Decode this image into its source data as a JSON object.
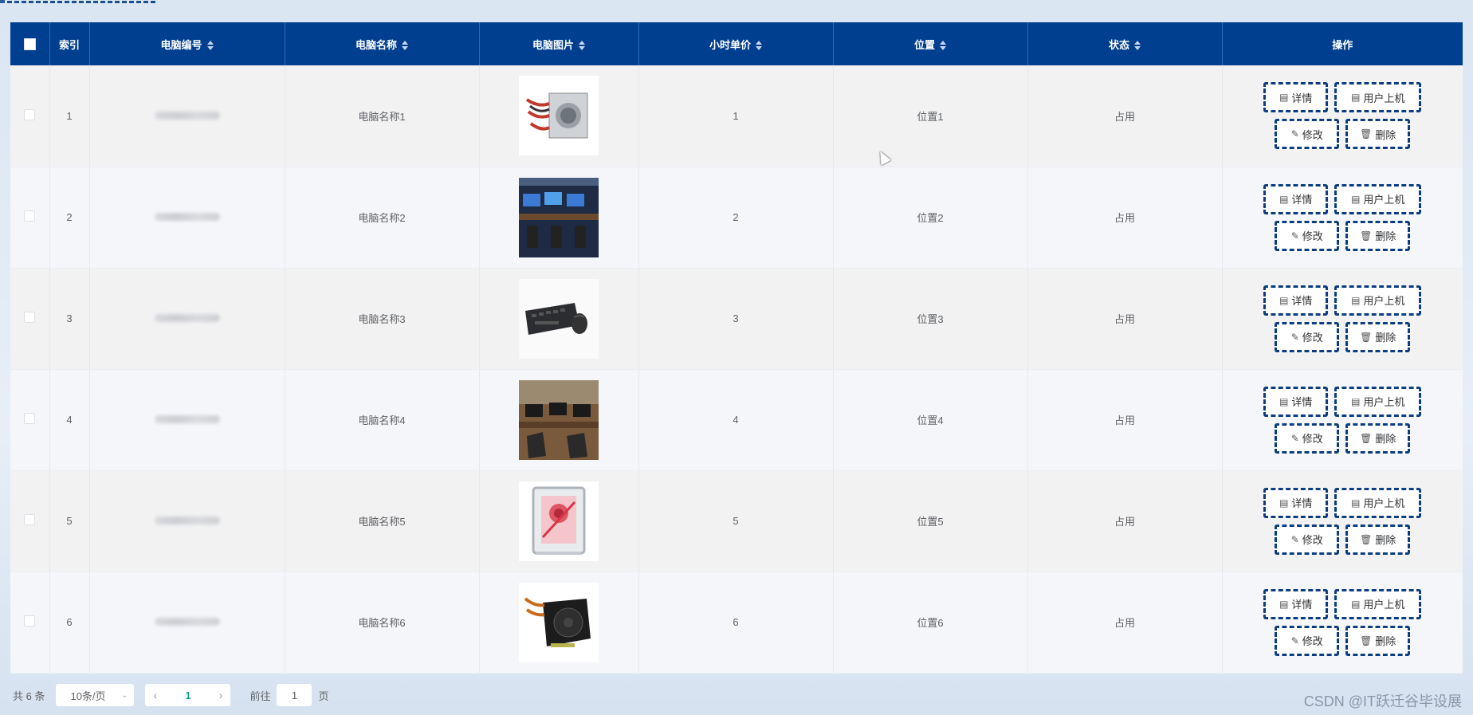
{
  "table": {
    "headers": {
      "index": "索引",
      "pc_code": "电脑编号",
      "pc_name": "电脑名称",
      "pc_image": "电脑图片",
      "hourly_price": "小时单价",
      "location": "位置",
      "status": "状态",
      "actions": "操作"
    },
    "rows": [
      {
        "index": "1",
        "name": "电脑名称1",
        "price": "1",
        "location": "位置1",
        "status": "占用",
        "image": "power-supply-white"
      },
      {
        "index": "2",
        "name": "电脑名称2",
        "price": "2",
        "location": "位置2",
        "status": "占用",
        "image": "internet-cafe"
      },
      {
        "index": "3",
        "name": "电脑名称3",
        "price": "3",
        "location": "位置3",
        "status": "占用",
        "image": "keyboard-mouse"
      },
      {
        "index": "4",
        "name": "电脑名称4",
        "price": "4",
        "location": "位置4",
        "status": "占用",
        "image": "computer-room"
      },
      {
        "index": "5",
        "name": "电脑名称5",
        "price": "5",
        "location": "位置5",
        "status": "占用",
        "image": "pc-case-red"
      },
      {
        "index": "6",
        "name": "电脑名称6",
        "price": "6",
        "location": "位置6",
        "status": "占用",
        "image": "power-supply-black"
      }
    ],
    "actions": {
      "detail": "详情",
      "user_login": "用户上机",
      "edit": "修改",
      "delete": "删除"
    }
  },
  "pagination": {
    "total": "共 6 条",
    "page_size": "10条/页",
    "current_page": "1",
    "goto_label": "前往",
    "goto_value": "1",
    "page_suffix": "页"
  },
  "watermark": "CSDN @IT跃迁谷毕设展",
  "colors": {
    "header_bg": "#003f8f",
    "button_border": "#0b3d80",
    "page_active": "#1a9aa0"
  }
}
